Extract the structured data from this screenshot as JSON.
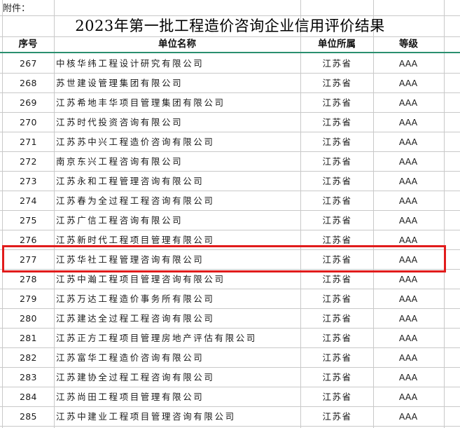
{
  "attachment_label": "附件：",
  "title": "2023年第一批工程造价咨询企业信用评价结果",
  "headers": {
    "index": "序号",
    "name": "单位名称",
    "region": "单位所属",
    "grade": "等级"
  },
  "rows": [
    {
      "index": "267",
      "name": "中核华纬工程设计研究有限公司",
      "region": "江苏省",
      "grade": "AAA"
    },
    {
      "index": "268",
      "name": "苏世建设管理集团有限公司",
      "region": "江苏省",
      "grade": "AAA"
    },
    {
      "index": "269",
      "name": "江苏希地丰华项目管理集团有限公司",
      "region": "江苏省",
      "grade": "AAA"
    },
    {
      "index": "270",
      "name": "江苏时代投资咨询有限公司",
      "region": "江苏省",
      "grade": "AAA"
    },
    {
      "index": "271",
      "name": "江苏苏中兴工程造价咨询有限公司",
      "region": "江苏省",
      "grade": "AAA"
    },
    {
      "index": "272",
      "name": "南京东兴工程咨询有限公司",
      "region": "江苏省",
      "grade": "AAA"
    },
    {
      "index": "273",
      "name": "江苏永和工程管理咨询有限公司",
      "region": "江苏省",
      "grade": "AAA"
    },
    {
      "index": "274",
      "name": "江苏春为全过程工程咨询有限公司",
      "region": "江苏省",
      "grade": "AAA"
    },
    {
      "index": "275",
      "name": "江苏广信工程咨询有限公司",
      "region": "江苏省",
      "grade": "AAA"
    },
    {
      "index": "276",
      "name": "江苏新时代工程项目管理有限公司",
      "region": "江苏省",
      "grade": "AAA"
    },
    {
      "index": "277",
      "name": "江苏华社工程管理咨询有限公司",
      "region": "江苏省",
      "grade": "AAA"
    },
    {
      "index": "278",
      "name": "江苏中瀚工程项目管理咨询有限公司",
      "region": "江苏省",
      "grade": "AAA"
    },
    {
      "index": "279",
      "name": "江苏万达工程造价事务所有限公司",
      "region": "江苏省",
      "grade": "AAA"
    },
    {
      "index": "280",
      "name": "江苏建达全过程工程咨询有限公司",
      "region": "江苏省",
      "grade": "AAA"
    },
    {
      "index": "281",
      "name": "江苏正方工程项目管理房地产评估有限公司",
      "region": "江苏省",
      "grade": "AAA"
    },
    {
      "index": "282",
      "name": "江苏富华工程造价咨询有限公司",
      "region": "江苏省",
      "grade": "AAA"
    },
    {
      "index": "283",
      "name": "江苏建协全过程工程咨询有限公司",
      "region": "江苏省",
      "grade": "AAA"
    },
    {
      "index": "284",
      "name": "江苏尚田工程项目管理有限公司",
      "region": "江苏省",
      "grade": "AAA"
    },
    {
      "index": "285",
      "name": "江苏中建业工程项目管理咨询有限公司",
      "region": "江苏省",
      "grade": "AAA"
    }
  ],
  "highlighted_index": "277",
  "colors": {
    "highlight": "#e11b1b",
    "header_rule": "#2a8f6f",
    "grid": "#c9c9c9"
  }
}
